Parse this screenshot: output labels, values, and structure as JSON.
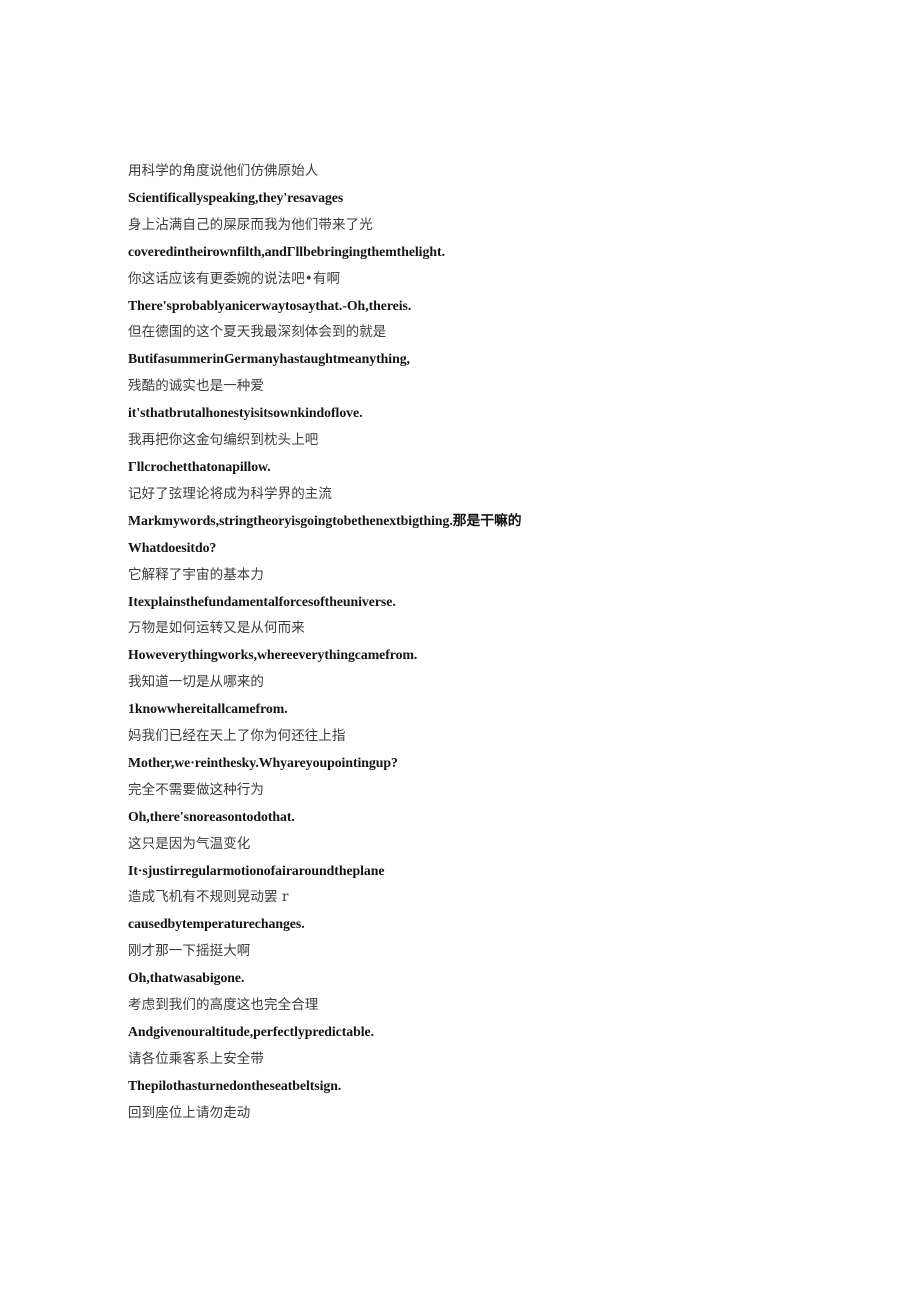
{
  "document": {
    "background_color": "#ffffff",
    "text_color_zh": "#3c3c3c",
    "text_color_en": "#141414",
    "lines": [
      {
        "id": "l1",
        "lang": "zh",
        "text": "用科学的角度说他们仿佛原始人"
      },
      {
        "id": "l2",
        "lang": "en",
        "text": "Scientificallyspeaking,they'resavages"
      },
      {
        "id": "l3",
        "lang": "zh",
        "text": "身上沾满自己的屎尿而我为他们带来了光"
      },
      {
        "id": "l4",
        "lang": "en",
        "text": "coveredintheirownfilth,andΓllbebringingthemthelight."
      },
      {
        "id": "l5",
        "lang": "zh",
        "text": "你这话应该有更委婉的说法吧•有啊"
      },
      {
        "id": "l6",
        "lang": "en",
        "text": "There'sprobablyanicerwaytosaythat.-Oh,thereis."
      },
      {
        "id": "l7",
        "lang": "zh",
        "text": "但在德国的这个夏天我最深刻体会到的就是"
      },
      {
        "id": "l8",
        "lang": "en",
        "text": "ButifasummerinGermanyhastaughtmeanything,"
      },
      {
        "id": "l9",
        "lang": "zh",
        "text": "残酷的诚实也是一种爱"
      },
      {
        "id": "l10",
        "lang": "en",
        "text": "it'sthatbrutalhonestyisitsownkindoflove."
      },
      {
        "id": "l11",
        "lang": "zh",
        "text": "我再把你这金句编织到枕头上吧"
      },
      {
        "id": "l12",
        "lang": "en",
        "text": "Γllcrochetthatonapillow."
      },
      {
        "id": "l13",
        "lang": "zh",
        "text": "记好了弦理论将成为科学界的主流"
      },
      {
        "id": "l14",
        "lang": "en",
        "wrap": true,
        "text": "Markmywords,stringtheoryisgoingtobethenextbigthing.那是干嘛的"
      },
      {
        "id": "l15",
        "lang": "en",
        "text": "Whatdoesitdo?"
      },
      {
        "id": "l16",
        "lang": "zh",
        "text": "它解释了宇宙的基本力"
      },
      {
        "id": "l17",
        "lang": "en",
        "text": "Itexplainsthefundamentalforcesoftheuniverse."
      },
      {
        "id": "l18",
        "lang": "zh",
        "text": "万物是如何运转又是从何而来"
      },
      {
        "id": "l19",
        "lang": "en",
        "text": "Howeverythingworks,whereeverythingcamefrom."
      },
      {
        "id": "l20",
        "lang": "zh",
        "text": "我知道一切是从哪来的"
      },
      {
        "id": "l21",
        "lang": "en",
        "text": "1knowwhereitallcamefrom."
      },
      {
        "id": "l22",
        "lang": "zh",
        "text": "妈我们已经在天上了你为何还往上指"
      },
      {
        "id": "l23",
        "lang": "en",
        "text": "Mother,we·reinthesky.Whyareyoupointingup?"
      },
      {
        "id": "l24",
        "lang": "zh",
        "text": "完全不需要做这种行为"
      },
      {
        "id": "l25",
        "lang": "en",
        "text": "Oh,there'snoreasontodothat."
      },
      {
        "id": "l26",
        "lang": "zh",
        "text": "这只是因为气温变化"
      },
      {
        "id": "l27",
        "lang": "en",
        "text": "It·sjustirregularmotionofairaroundtheplane"
      },
      {
        "id": "l28",
        "lang": "zh",
        "text": "造成飞机有不规则晃动罢 r"
      },
      {
        "id": "l29",
        "lang": "en",
        "text": "causedbytemperaturechanges."
      },
      {
        "id": "l30",
        "lang": "zh",
        "text": "刚才那一下摇挺大啊"
      },
      {
        "id": "l31",
        "lang": "en",
        "text": "Oh,thatwasabigone."
      },
      {
        "id": "l32",
        "lang": "zh",
        "text": "考虑到我们的高度这也完全合理"
      },
      {
        "id": "l33",
        "lang": "en",
        "text": "Andgivenouraltitude,perfectlypredictable."
      },
      {
        "id": "l34",
        "lang": "zh",
        "text": "请各位乘客系上安全带"
      },
      {
        "id": "l35",
        "lang": "en",
        "text": "Thepilothasturnedontheseatbeltsign."
      },
      {
        "id": "l36",
        "lang": "zh",
        "text": "回到座位上请勿走动"
      }
    ]
  }
}
